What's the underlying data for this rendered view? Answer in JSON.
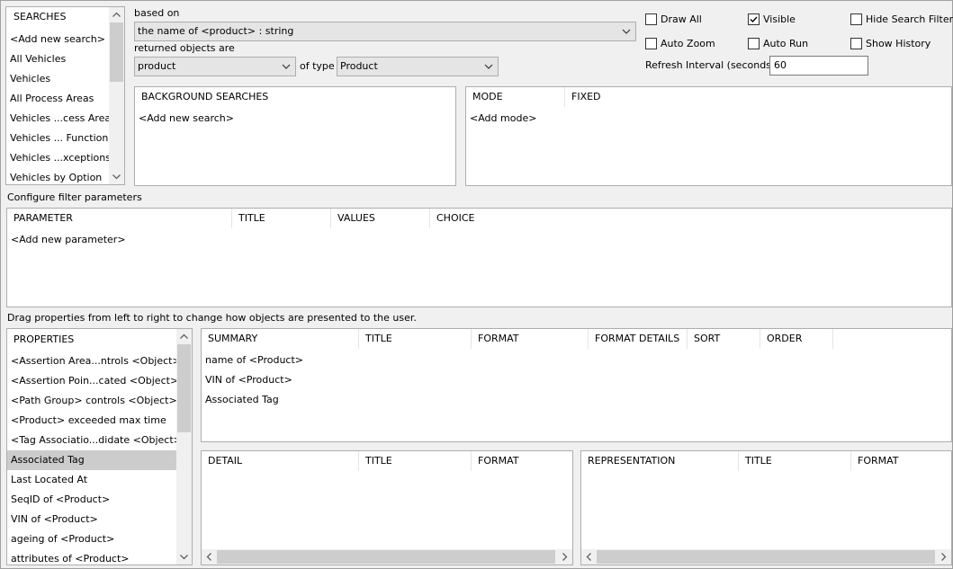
{
  "searches": {
    "header": "SEARCHES",
    "items": [
      "<Add new search>",
      "All Vehicles",
      "Vehicles",
      "All Process Areas",
      "Vehicles ...cess Area",
      "Vehicles ... Function",
      "Vehicles ...xceptions",
      "Vehicles by Option"
    ]
  },
  "based_on": {
    "label": "based on",
    "value": "the name of <product> : string"
  },
  "returned": {
    "label": "returned objects are",
    "value": "product",
    "of_type_label": "of type",
    "type_value": "Product"
  },
  "options": {
    "draw_all": {
      "label": "Draw All",
      "checked": false
    },
    "visible": {
      "label": "Visible",
      "checked": true
    },
    "hide_search_filter": {
      "label": "Hide Search Filter",
      "checked": false
    },
    "auto_zoom": {
      "label": "Auto Zoom",
      "checked": false
    },
    "auto_run": {
      "label": "Auto Run",
      "checked": false
    },
    "show_history": {
      "label": "Show History",
      "checked": false
    },
    "refresh_label": "Refresh Interval (seconds)",
    "refresh_value": "60"
  },
  "background_searches": {
    "header": "BACKGROUND SEARCHES",
    "items": [
      "<Add new search>"
    ]
  },
  "modes": {
    "headers": [
      "MODE",
      "FIXED"
    ],
    "items": [
      "<Add mode>"
    ]
  },
  "filter": {
    "title": "Configure filter parameters",
    "headers": [
      "PARAMETER",
      "TITLE",
      "VALUES",
      "CHOICE"
    ],
    "items": [
      "<Add new parameter>"
    ]
  },
  "drag_hint": "Drag properties from left to right to change how objects are presented to the user.",
  "properties": {
    "header": "PROPERTIES",
    "items": [
      "<Assertion Area...ntrols <Object>",
      "<Assertion Poin...cated <Object>",
      "<Path Group> controls <Object>",
      "<Product> exceeded max time",
      "<Tag Associatio...didate <Object>",
      "Associated Tag",
      "Last Located At",
      "SeqID of <Product>",
      "VIN of <Product>",
      "ageing of <Product>",
      "attributes of <Product>"
    ],
    "selected_index": 5
  },
  "summary": {
    "headers": [
      "SUMMARY",
      "TITLE",
      "FORMAT",
      "FORMAT DETAILS",
      "SORT",
      "ORDER"
    ],
    "items": [
      "name of <Product>",
      "VIN of <Product>",
      "Associated Tag"
    ]
  },
  "detail": {
    "headers": [
      "DETAIL",
      "TITLE",
      "FORMAT"
    ]
  },
  "representation": {
    "headers": [
      "REPRESENTATION",
      "TITLE",
      "FORMAT"
    ]
  },
  "colors": {
    "selection": "#cccccc",
    "background": "#f0f0f0",
    "border": "#adadad"
  }
}
